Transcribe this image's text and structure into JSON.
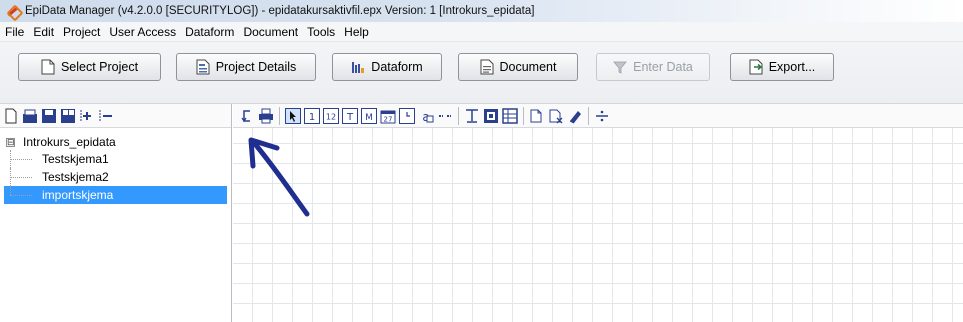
{
  "window": {
    "title": "EpiData Manager (v4.2.0.0 [SECURITYLOG]) - epidatakursaktivfil.epx Version: 1 [Introkurs_epidata]"
  },
  "menu": {
    "items": [
      "File",
      "Edit",
      "Project",
      "User Access",
      "Dataform",
      "Document",
      "Tools",
      "Help"
    ]
  },
  "toolbar": {
    "select_project": "Select Project",
    "project_details": "Project Details",
    "dataform": "Dataform",
    "document": "Document",
    "enter_data": "Enter Data",
    "export": "Export..."
  },
  "left_toolbar": {
    "icons": [
      "new-dataform-icon",
      "open-icon",
      "save-icon",
      "save-all-icon",
      "add-icon",
      "remove-icon"
    ]
  },
  "tree": {
    "root": "Introkurs_epidata",
    "root_expander": "⊟",
    "children": [
      "Testskjema1",
      "Testskjema2",
      "importskjema"
    ],
    "selected_index": 2
  },
  "designer_toolbar": {
    "icons": [
      "undo-icon",
      "print-icon",
      "pointer-icon",
      "integer-field-icon",
      "float-field-icon",
      "text-field-icon",
      "memo-field-icon",
      "date-field-icon",
      "time-field-icon",
      "auto-field-icon",
      "link-icon",
      "heading-icon",
      "section-icon",
      "table-icon",
      "copy-icon",
      "clear-icon",
      "eraser-icon",
      "divider-icon"
    ]
  },
  "colors": {
    "selection": "#3399ff",
    "annotation_arrow": "#1f2e8f"
  }
}
